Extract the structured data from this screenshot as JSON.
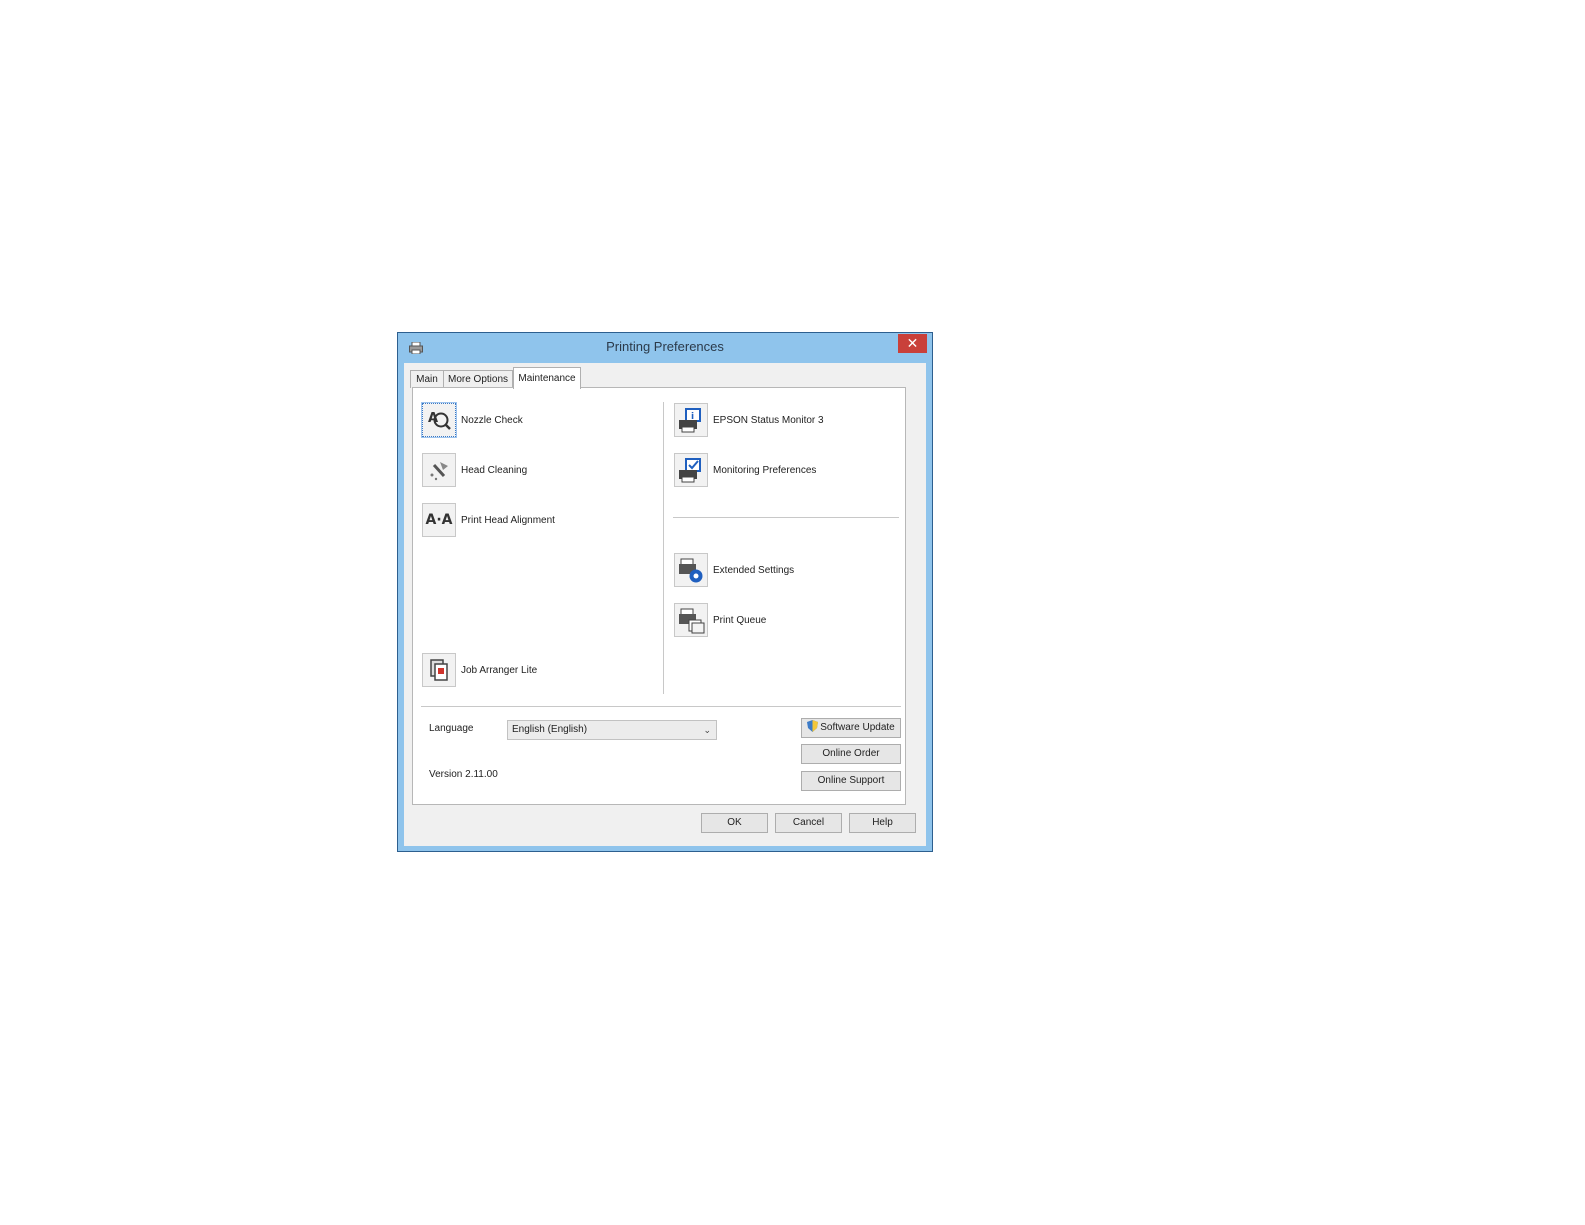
{
  "window": {
    "title": "Printing Preferences",
    "close_glyph": "✕"
  },
  "tabs": [
    {
      "label": "Main",
      "active": false
    },
    {
      "label": "More Options",
      "active": false
    },
    {
      "label": "Maintenance",
      "active": true
    }
  ],
  "left_items": [
    {
      "label": "Nozzle Check",
      "icon": "nozzle-check-icon"
    },
    {
      "label": "Head Cleaning",
      "icon": "head-cleaning-icon"
    },
    {
      "label": "Print Head Alignment",
      "icon": "print-head-alignment-icon"
    },
    {
      "label": "Job Arranger Lite",
      "icon": "job-arranger-icon"
    }
  ],
  "right_items": [
    {
      "label": "EPSON Status Monitor 3",
      "icon": "status-monitor-icon"
    },
    {
      "label": "Monitoring Preferences",
      "icon": "monitoring-preferences-icon"
    },
    {
      "label": "Extended Settings",
      "icon": "extended-settings-icon"
    },
    {
      "label": "Print Queue",
      "icon": "print-queue-icon"
    }
  ],
  "alignment_icon_text": "A·A",
  "language": {
    "label": "Language",
    "selected": "English (English)"
  },
  "version": "Version 2.11.00",
  "side_buttons": {
    "software_update": "Software Update",
    "online_order": "Online Order",
    "online_support": "Online Support"
  },
  "footer_buttons": {
    "ok": "OK",
    "cancel": "Cancel",
    "help": "Help"
  },
  "colors": {
    "titlebar": "#8fc4ec",
    "close": "#c9403a",
    "accent": "#1f5fbf"
  }
}
